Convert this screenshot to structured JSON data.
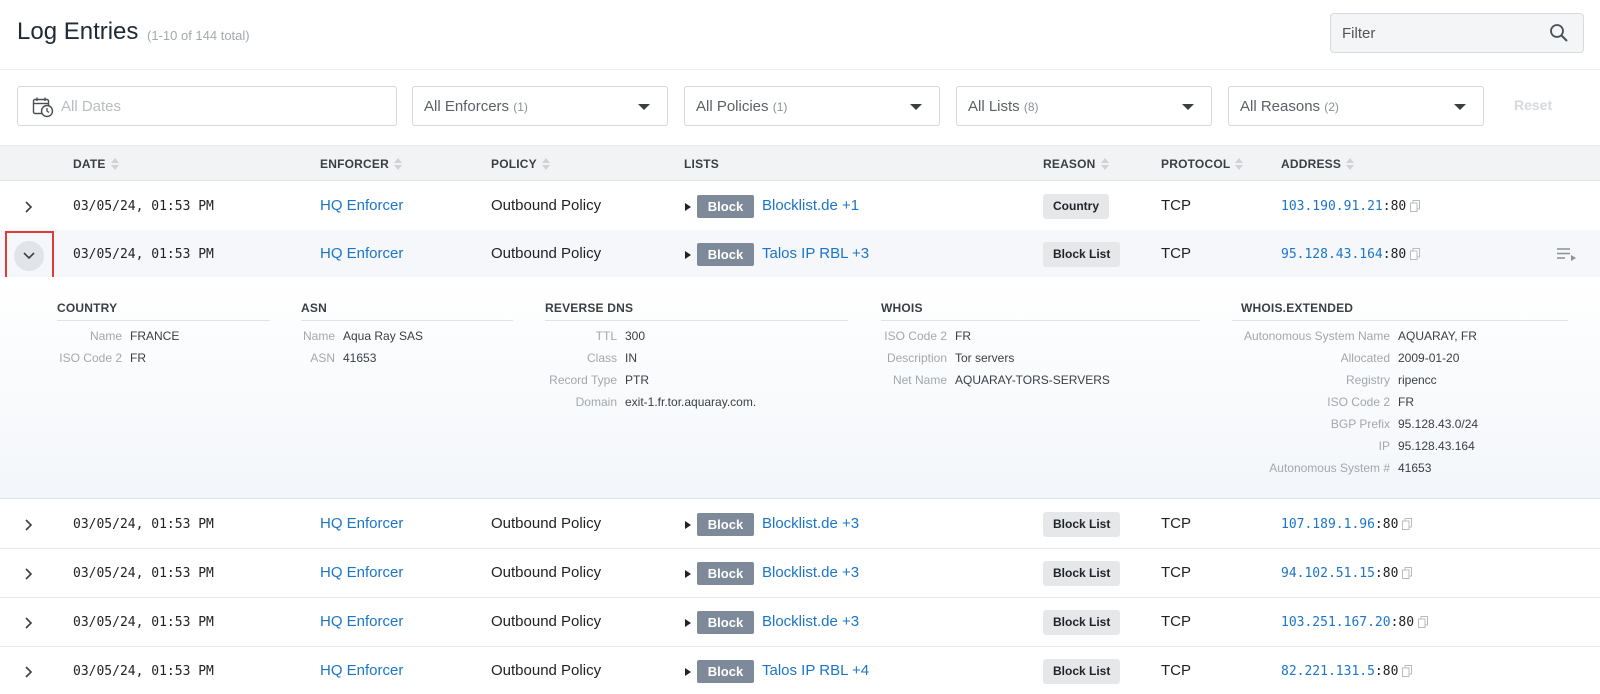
{
  "header": {
    "title": "Log Entries",
    "count": "(1-10 of 144 total)",
    "filter_placeholder": "Filter"
  },
  "filters": {
    "dates_placeholder": "All Dates",
    "enforcers_label": "All Enforcers",
    "enforcers_count": "(1)",
    "policies_label": "All Policies",
    "policies_count": "(1)",
    "lists_label": "All Lists",
    "lists_count": "(8)",
    "reasons_label": "All Reasons",
    "reasons_count": "(2)",
    "reset_label": "Reset"
  },
  "columns": {
    "date": "DATE",
    "enforcer": "ENFORCER",
    "policy": "POLICY",
    "lists": "LISTS",
    "reason": "REASON",
    "protocol": "PROTOCOL",
    "address": "ADDRESS"
  },
  "rows": [
    {
      "date": "03/05/24, 01:53 PM",
      "enforcer": "HQ Enforcer",
      "policy": "Outbound Policy",
      "action": "Block",
      "lists": "Blocklist.de +1",
      "reason": "Country",
      "protocol": "TCP",
      "ip": "103.190.91.21",
      "port": ":80"
    },
    {
      "date": "03/05/24, 01:53 PM",
      "enforcer": "HQ Enforcer",
      "policy": "Outbound Policy",
      "action": "Block",
      "lists": "Talos IP RBL +3",
      "reason": "Block List",
      "protocol": "TCP",
      "ip": "95.128.43.164",
      "port": ":80"
    },
    {
      "date": "03/05/24, 01:53 PM",
      "enforcer": "HQ Enforcer",
      "policy": "Outbound Policy",
      "action": "Block",
      "lists": "Blocklist.de +3",
      "reason": "Block List",
      "protocol": "TCP",
      "ip": "107.189.1.96",
      "port": ":80"
    },
    {
      "date": "03/05/24, 01:53 PM",
      "enforcer": "HQ Enforcer",
      "policy": "Outbound Policy",
      "action": "Block",
      "lists": "Blocklist.de +3",
      "reason": "Block List",
      "protocol": "TCP",
      "ip": "94.102.51.15",
      "port": ":80"
    },
    {
      "date": "03/05/24, 01:53 PM",
      "enforcer": "HQ Enforcer",
      "policy": "Outbound Policy",
      "action": "Block",
      "lists": "Blocklist.de +3",
      "reason": "Block List",
      "protocol": "TCP",
      "ip": "103.251.167.20",
      "port": ":80"
    },
    {
      "date": "03/05/24, 01:53 PM",
      "enforcer": "HQ Enforcer",
      "policy": "Outbound Policy",
      "action": "Block",
      "lists": "Talos IP RBL +4",
      "reason": "Block List",
      "protocol": "TCP",
      "ip": "82.221.131.5",
      "port": ":80"
    }
  ],
  "details": {
    "country": {
      "title": "COUNTRY",
      "items": [
        {
          "k": "Name",
          "v": "FRANCE"
        },
        {
          "k": "ISO Code 2",
          "v": "FR"
        }
      ]
    },
    "asn": {
      "title": "ASN",
      "items": [
        {
          "k": "Name",
          "v": "Aqua Ray SAS"
        },
        {
          "k": "ASN",
          "v": "41653"
        }
      ]
    },
    "reverse_dns": {
      "title": "REVERSE DNS",
      "items": [
        {
          "k": "TTL",
          "v": "300"
        },
        {
          "k": "Class",
          "v": "IN"
        },
        {
          "k": "Record Type",
          "v": "PTR"
        },
        {
          "k": "Domain",
          "v": "exit-1.fr.tor.aquaray.com."
        }
      ]
    },
    "whois": {
      "title": "WHOIS",
      "items": [
        {
          "k": "ISO Code 2",
          "v": "FR"
        },
        {
          "k": "Description",
          "v": "Tor servers"
        },
        {
          "k": "Net Name",
          "v": "AQUARAY-TORS-SERVERS"
        }
      ]
    },
    "whois_extended": {
      "title": "WHOIS.EXTENDED",
      "items": [
        {
          "k": "Autonomous System Name",
          "v": "AQUARAY, FR"
        },
        {
          "k": "Allocated",
          "v": "2009-01-20"
        },
        {
          "k": "Registry",
          "v": "ripencc"
        },
        {
          "k": "ISO Code 2",
          "v": "FR"
        },
        {
          "k": "BGP Prefix",
          "v": "95.128.43.0/24"
        },
        {
          "k": "IP",
          "v": "95.128.43.164"
        },
        {
          "k": "Autonomous System #",
          "v": "41653"
        }
      ]
    }
  },
  "colors": {
    "link": "#1b75c9",
    "block_badge": "#7e8a99",
    "highlight": "#e23a3a"
  }
}
